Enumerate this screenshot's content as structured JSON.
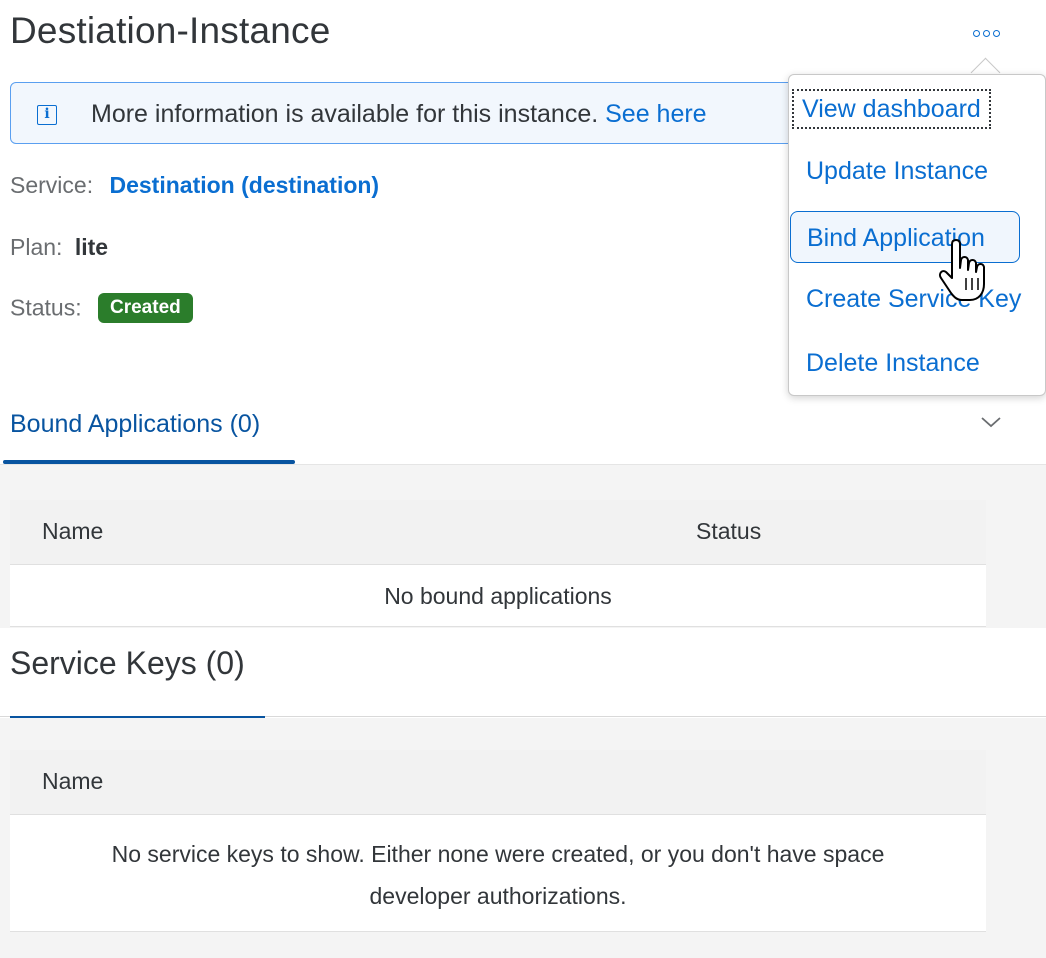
{
  "header": {
    "title": "Destiation-Instance",
    "more_icon": "overflow-dots-icon"
  },
  "info_strip": {
    "icon": "info-icon",
    "message": "More information is available for this instance. ",
    "link": "See here"
  },
  "properties": {
    "service_label": "Service:",
    "service_value": "Destination (destination)",
    "plan_label": "Plan:",
    "plan_value": "lite",
    "status_label": "Status:",
    "status_value": "Created"
  },
  "bound_apps": {
    "tab_label": "Bound Applications (0)",
    "columns": [
      "Name",
      "Status"
    ],
    "empty_text": "No bound applications"
  },
  "service_keys": {
    "title": "Service Keys (0)",
    "columns": [
      "Name"
    ],
    "empty_line1": "No service keys to show. Either none were created, or you don't have space",
    "empty_line2": "developer authorizations."
  },
  "menu": {
    "items": [
      {
        "label": "View dashboard"
      },
      {
        "label": "Update Instance"
      },
      {
        "label": "Bind Application"
      },
      {
        "label": "Create Service Key"
      },
      {
        "label": "Delete Instance"
      }
    ]
  },
  "colors": {
    "accent": "#0a6ed1",
    "status_success": "#2b7d2b",
    "tab_active": "#0854a0"
  }
}
